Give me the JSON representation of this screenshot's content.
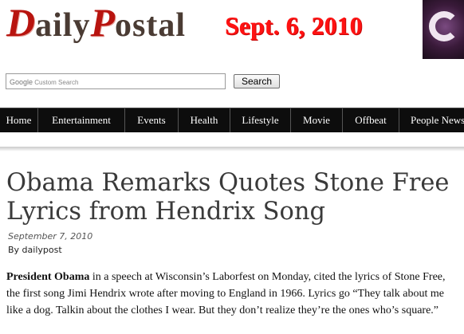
{
  "header": {
    "logo_initial_1": "D",
    "logo_rest_1": "aily",
    "logo_initial_2": "P",
    "logo_rest_2": "ostal",
    "edition_date": "Sept. 6, 2010"
  },
  "search": {
    "placeholder_brand": "Google",
    "placeholder_text": "Custom Search",
    "button_label": "Search"
  },
  "nav": {
    "items": [
      {
        "label": "Home"
      },
      {
        "label": "Entertainment"
      },
      {
        "label": "Events"
      },
      {
        "label": "Health"
      },
      {
        "label": "Lifestyle"
      },
      {
        "label": "Movie"
      },
      {
        "label": "Offbeat"
      },
      {
        "label": "People News"
      }
    ]
  },
  "article": {
    "title": "Obama Remarks Quotes Stone Free Lyrics from Hendrix Song",
    "date": "September 7, 2010",
    "byline": "By dailypost",
    "lead_bold": "President Obama",
    "lead_text": " in a speech at Wisconsin’s Laborfest on Monday, cited the lyrics of Stone Free, the first song Jimi Hendrix wrote after moving to England in 1966. Lyrics go “They talk about me like a dog. Talkin about the clothes I wear. But they don’t realize they’re the ones who’s square.”"
  }
}
